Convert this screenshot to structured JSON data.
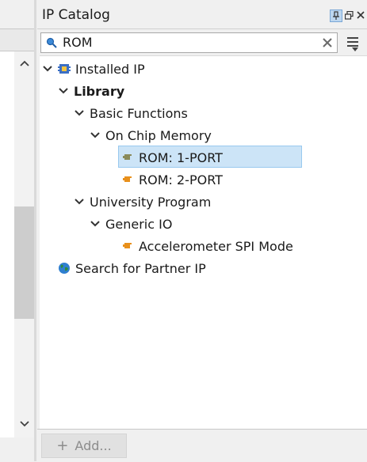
{
  "panel": {
    "title": "IP Catalog",
    "pin_icon": "pin-icon",
    "float_icon": "float-window-icon",
    "close_icon": "close-icon"
  },
  "search": {
    "value": "ROM",
    "icon": "search-icon",
    "clear_icon": "clear-icon"
  },
  "menu_icon": "hamburger-menu-icon",
  "tree": {
    "installed_ip": "Installed IP",
    "library": "Library",
    "basic_functions": "Basic Functions",
    "on_chip_memory": "On Chip Memory",
    "rom_1port": "ROM: 1-PORT",
    "rom_2port": "ROM: 2-PORT",
    "university_program": "University Program",
    "generic_io": "Generic IO",
    "accelerometer": "Accelerometer SPI Mode",
    "search_partner": "Search for Partner IP",
    "selected": "ROM: 1-PORT"
  },
  "bottom": {
    "add_label": "Add..."
  },
  "colors": {
    "selection": "#cce4f7",
    "selection_border": "#99c9ef",
    "ip_icon": "#e8901c",
    "globe": "#2e8b3d"
  }
}
